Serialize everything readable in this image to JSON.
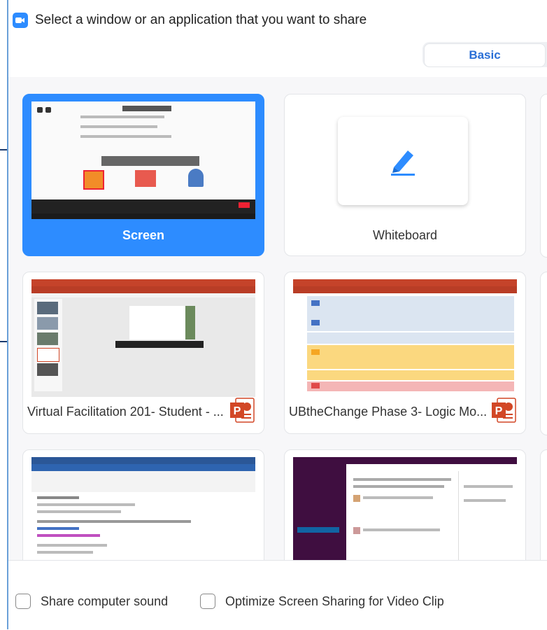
{
  "dialog": {
    "title": "Select a window or an application that you want to share"
  },
  "tabs": {
    "basic": "Basic"
  },
  "cards": [
    {
      "label": "Screen",
      "selected": true
    },
    {
      "label": "Whiteboard",
      "selected": false
    },
    {
      "label": "Virtual Facilitation 201- Student - ...",
      "app_icon": "powerpoint-icon"
    },
    {
      "label": "UBtheChange Phase 3- Logic Mo...",
      "app_icon": "powerpoint-icon"
    },
    {
      "label": "",
      "thumb": "outlook-email-window"
    },
    {
      "label": "",
      "thumb": "slack-window"
    }
  ],
  "options": {
    "share_sound": "Share computer sound",
    "optimize_video": "Optimize Screen Sharing for Video Clip"
  },
  "colors": {
    "accent": "#2d8cff",
    "ppt": "#d24726"
  }
}
